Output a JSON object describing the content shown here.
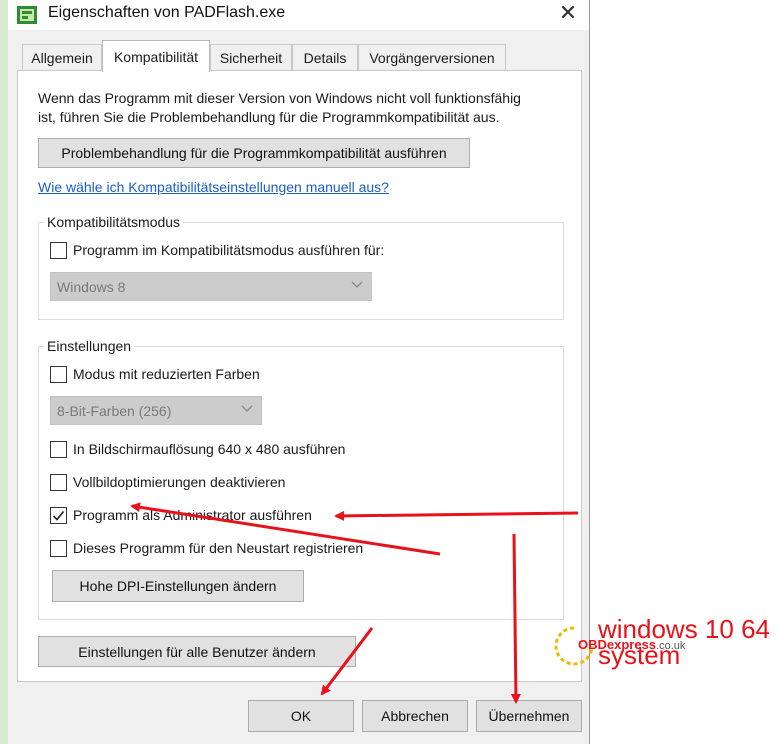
{
  "window": {
    "title": "Eigenschaften von PADFlash.exe",
    "close_glyph": "✕"
  },
  "tabs": [
    {
      "label": "Allgemein",
      "active": false
    },
    {
      "label": "Kompatibilität",
      "active": true
    },
    {
      "label": "Sicherheit",
      "active": false
    },
    {
      "label": "Details",
      "active": false
    },
    {
      "label": "Vorgängerversionen",
      "active": false
    }
  ],
  "intro": {
    "line1": "Wenn das Programm mit dieser Version von Windows nicht voll funktionsfähig",
    "line2": "ist, führen Sie die Problembehandlung für die Programmkompatibilität aus."
  },
  "troubleshoot_button": "Problembehandlung für die Programmkompatibilität ausführen",
  "manual_link": "Wie wähle ich Kompatibilitätseinstellungen manuell aus?",
  "compat_mode": {
    "group_label": "Kompatibilitätsmodus",
    "checkbox_label": "Programm im Kompatibilitätsmodus ausführen für:",
    "checked": false,
    "select_value": "Windows 8"
  },
  "settings": {
    "group_label": "Einstellungen",
    "reduced_colors": {
      "label": "Modus mit reduzierten Farben",
      "checked": false
    },
    "color_select_value": "8-Bit-Farben (256)",
    "resolution": {
      "label": "In Bildschirmauflösung 640 x 480 ausführen",
      "checked": false
    },
    "fullscreen_opt": {
      "label": "Vollbildoptimierungen deaktivieren",
      "checked": false
    },
    "run_as_admin": {
      "label": "Programm als Administrator ausführen",
      "checked": true
    },
    "restart_register": {
      "label": "Dieses Programm für den Neustart registrieren",
      "checked": false
    },
    "dpi_button": "Hohe DPI-Einstellungen ändern"
  },
  "all_users_button": "Einstellungen für alle Benutzer ändern",
  "footer": {
    "ok": "OK",
    "cancel": "Abbrechen",
    "apply": "Übernehmen"
  },
  "watermark": {
    "line1": "windows 10 64",
    "line2": "system",
    "logo_main": "OBDexpress",
    "logo_suffix": ".co.uk"
  },
  "colors": {
    "annotation_red": "#e8121a",
    "link_blue": "#1c5fc4"
  }
}
